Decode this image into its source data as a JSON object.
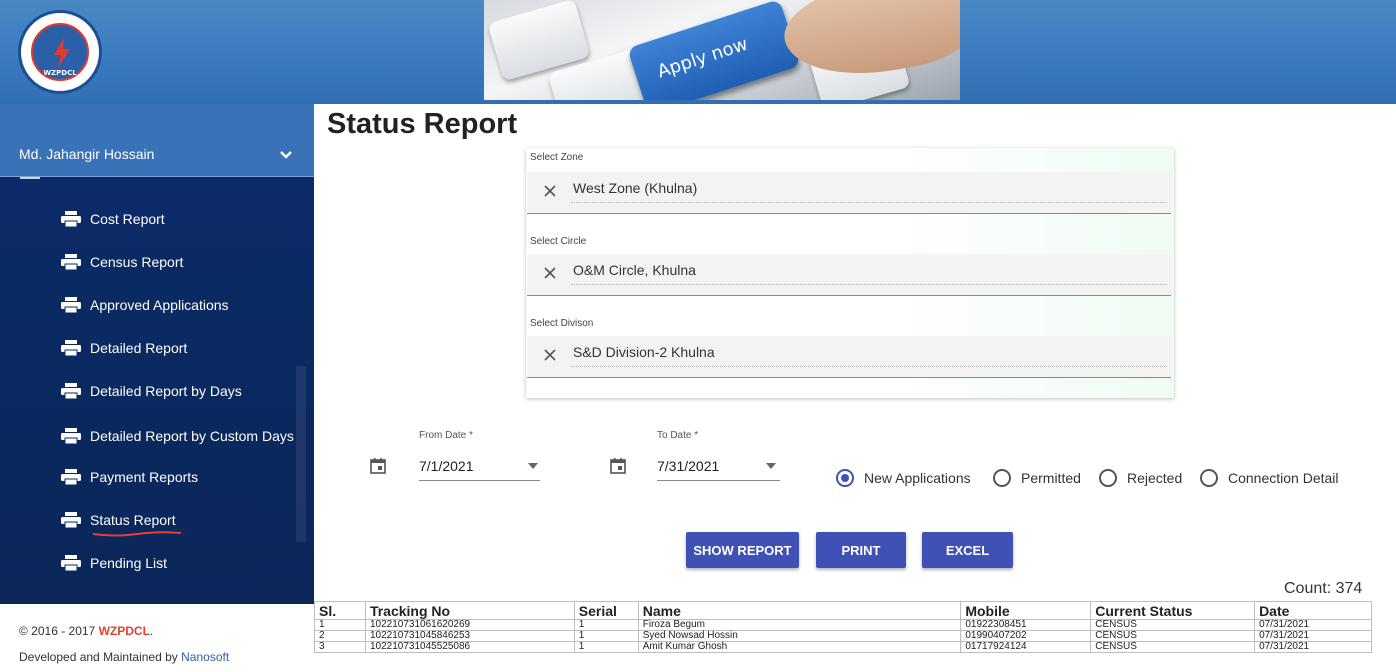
{
  "header": {
    "logo_text": "WZPDCL",
    "banner_key_text": "Apply now"
  },
  "sidebar": {
    "user_name": "Md. Jahangir Hossain",
    "items": [
      {
        "label": "Cost Report"
      },
      {
        "label": "Census Report"
      },
      {
        "label": "Approved Applications"
      },
      {
        "label": "Detailed Report"
      },
      {
        "label": "Detailed Report by Days"
      },
      {
        "label": "Detailed Report by Custom Days"
      },
      {
        "label": "Payment Reports"
      },
      {
        "label": "Status Report",
        "active": true
      },
      {
        "label": "Pending List"
      }
    ]
  },
  "footer": {
    "copyright": "© 2016 - 2017 ",
    "brand": "WZPDCL",
    "brand_suffix": ".",
    "developed_by": "Developed and Maintained by ",
    "developer": "Nanosoft"
  },
  "page": {
    "title": "Status Report"
  },
  "filters": {
    "zone": {
      "label": "Select Zone",
      "value": "West Zone (Khulna)"
    },
    "circle": {
      "label": "Select Circle",
      "value": "O&M Circle, Khulna"
    },
    "division": {
      "label": "Select Divison",
      "value": "S&D Division-2 Khulna"
    },
    "from_date": {
      "label": "From Date *",
      "value": "7/1/2021"
    },
    "to_date": {
      "label": "To Date *",
      "value": "7/31/2021"
    },
    "radios": [
      {
        "label": "New Applications",
        "selected": true
      },
      {
        "label": "Permitted",
        "selected": false
      },
      {
        "label": "Rejected",
        "selected": false
      },
      {
        "label": "Connection Detail",
        "selected": false
      }
    ]
  },
  "buttons": {
    "show_report": "SHOW REPORT",
    "print": "PRINT",
    "excel": "EXCEL"
  },
  "count_label": "Count: 374",
  "table": {
    "columns": [
      "Sl.",
      "Tracking No",
      "Serial",
      "Name",
      "Mobile",
      "Current Status",
      "Date"
    ],
    "rows": [
      [
        "1",
        "102210731061620269",
        "1",
        "Firoza Begum",
        "01922308451",
        "CENSUS",
        "07/31/2021"
      ],
      [
        "2",
        "102210731045846253",
        "1",
        "Syed Nowsad Hossin",
        "01990407202",
        "CENSUS",
        "07/31/2021"
      ],
      [
        "3",
        "102210731045525086",
        "1",
        "Amit Kumar Ghosh",
        "01717924124",
        "CENSUS",
        "07/31/2021"
      ]
    ]
  },
  "colors": {
    "primary": "#3f51b5",
    "sidebar_bg": "#0b2a62",
    "header_bg": "#3b7bbf",
    "brand_red": "#e2422f"
  }
}
